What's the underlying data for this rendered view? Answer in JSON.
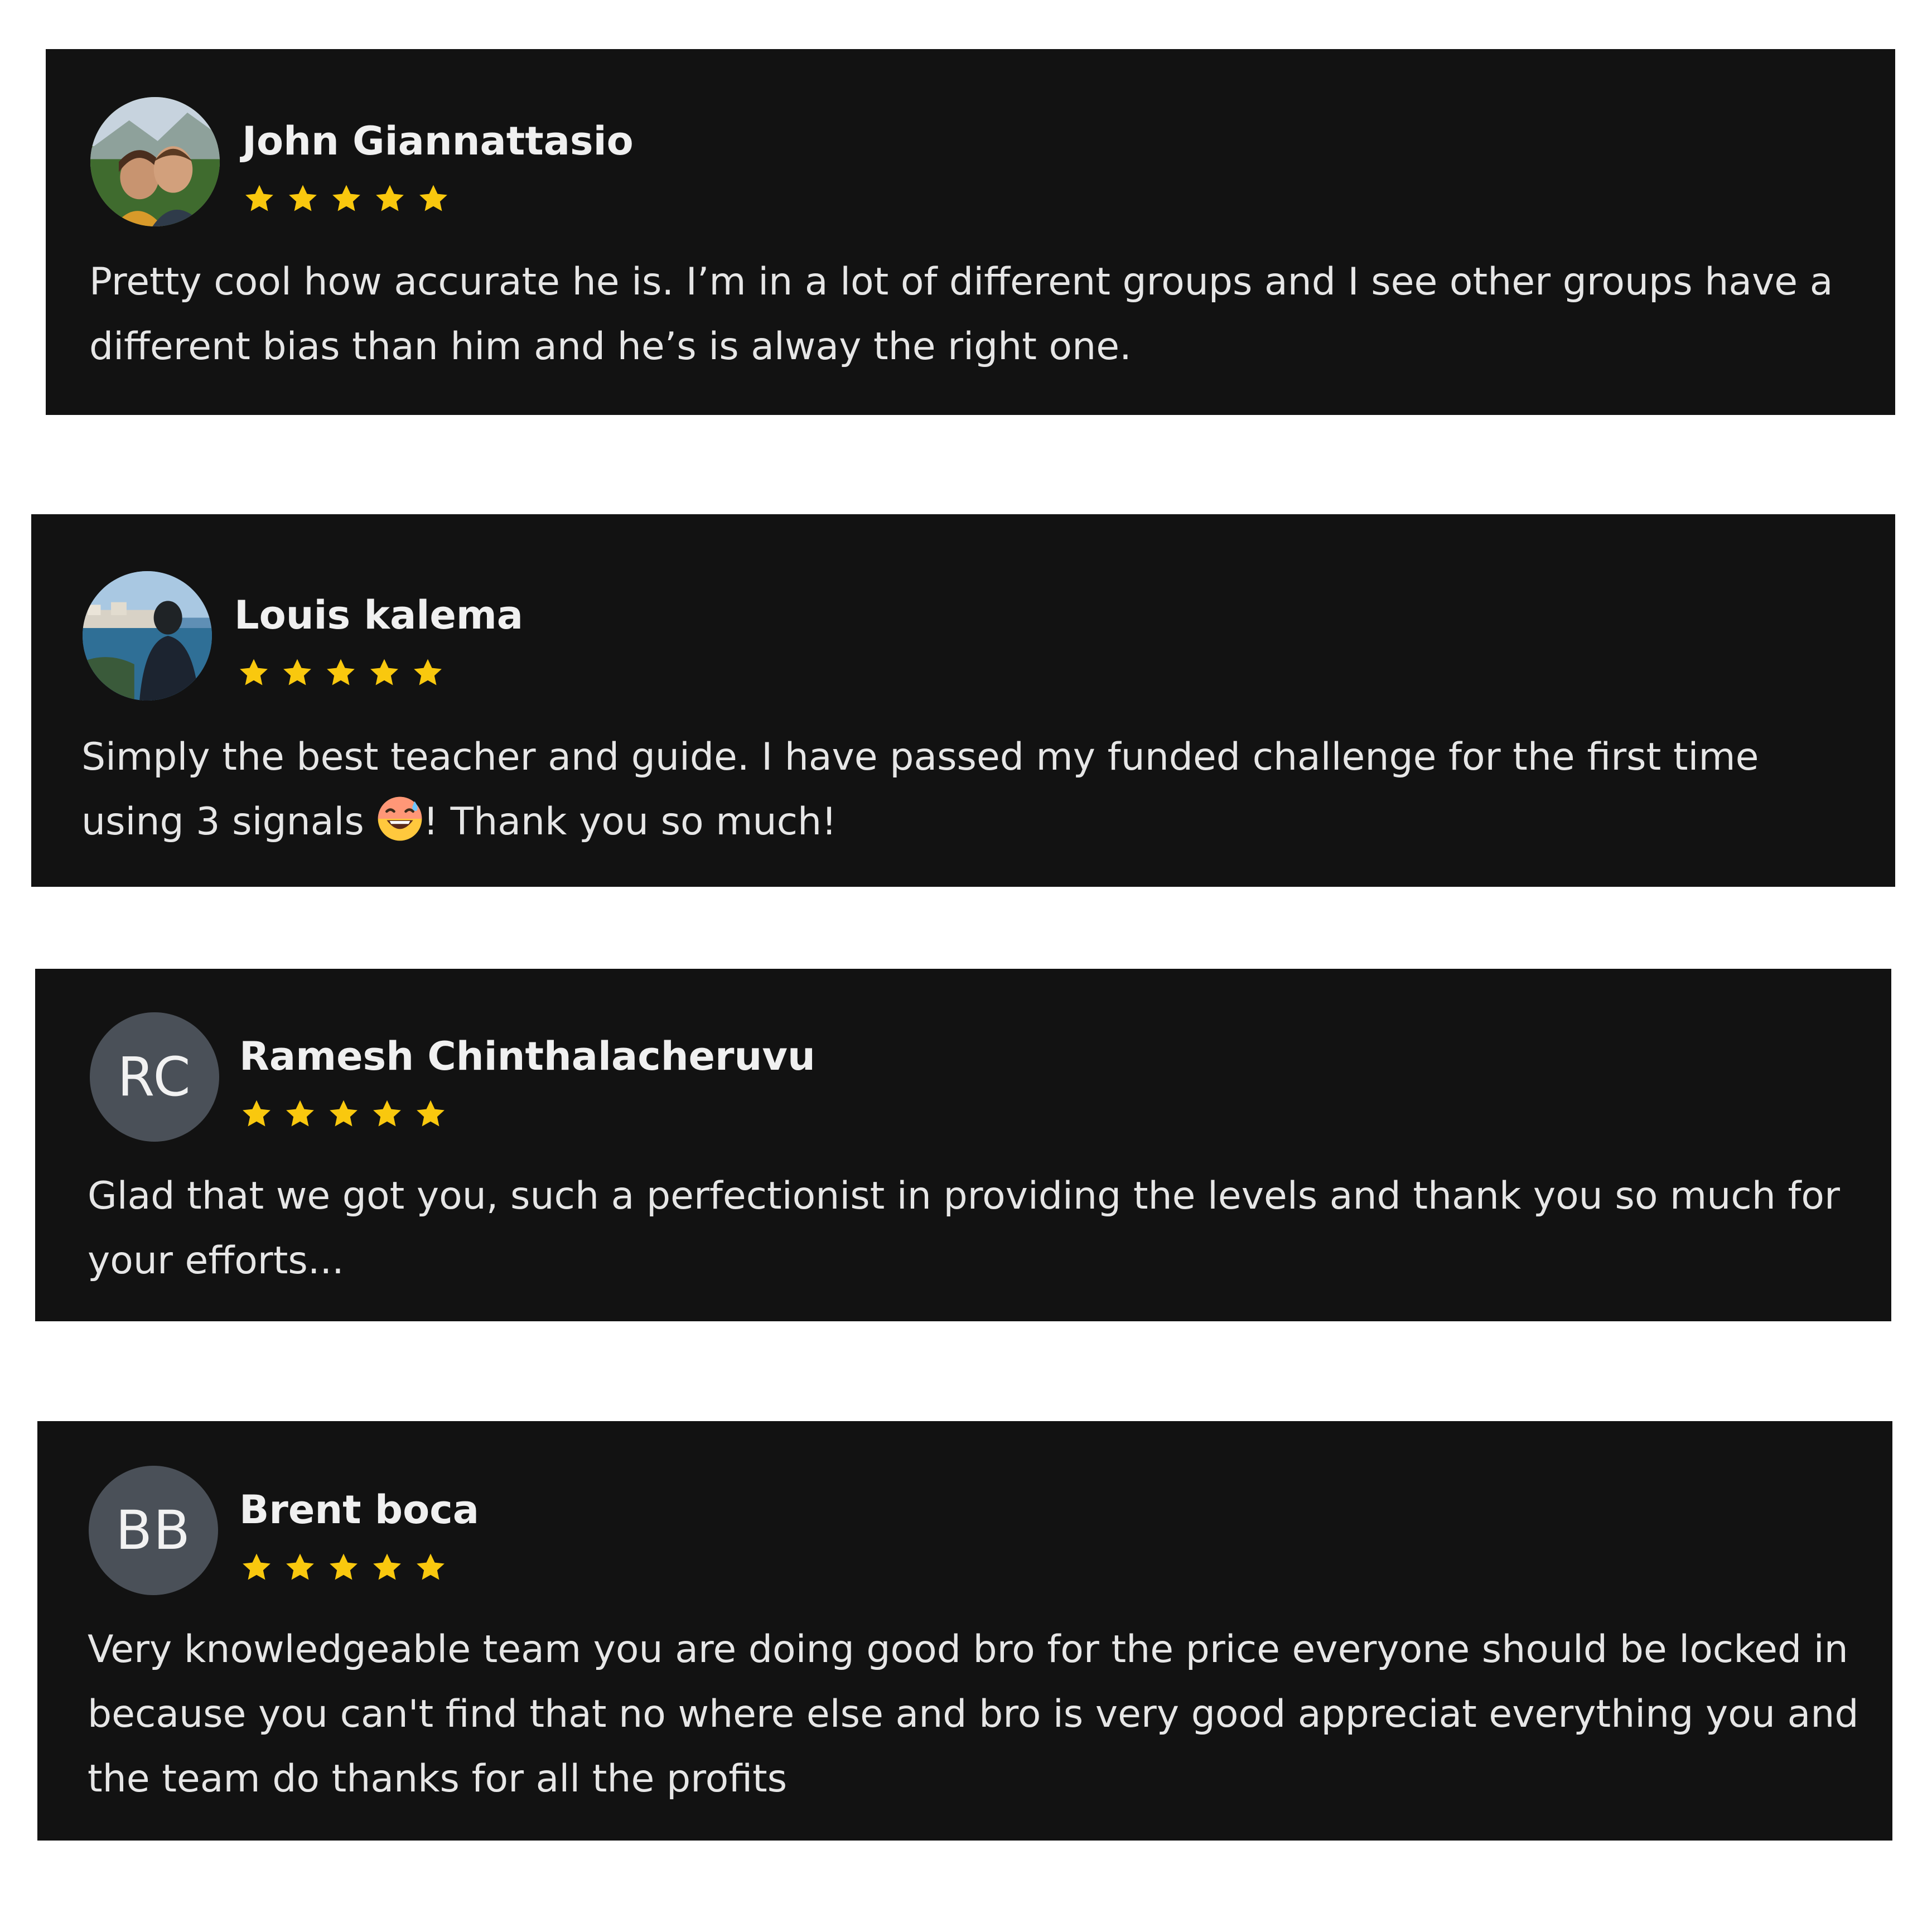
{
  "reviews": [
    {
      "name": "John Giannattasio",
      "rating": 5,
      "avatar": {
        "type": "photo",
        "icon": "couple-photo-avatar"
      },
      "text": "Pretty cool how accurate he is. I’m in a lot of different groups and I see other groups have a different bias than him and he’s is alway the right one."
    },
    {
      "name": "Louis kalema",
      "rating": 5,
      "avatar": {
        "type": "photo",
        "icon": "harbor-photo-avatar"
      },
      "text_before_emoji": "Simply the best teacher and guide. I have passed my funded challenge for the first time using 3 signals",
      "emoji": "smiling-face-with-sweat-icon",
      "text_after_emoji": "! Thank you so much!"
    },
    {
      "name": "Ramesh Chinthalacheruvu",
      "rating": 5,
      "avatar": {
        "type": "initials",
        "initials": "RC"
      },
      "text": "Glad that we got you, such a perfectionist in providing the levels and thank you so much for your efforts..."
    },
    {
      "name": "Brent boca",
      "rating": 5,
      "avatar": {
        "type": "initials",
        "initials": "BB"
      },
      "text": "Very knowledgeable team you are doing good bro for the price everyone should be locked in because you can't find that no where else and bro is very good appreciat everything you and the team do thanks for all the profits"
    }
  ],
  "colors": {
    "card_background": "#121212",
    "star": "#f9c80e",
    "name_text": "#f0f0f0",
    "body_text": "#e6e6e6",
    "initials_avatar_bg": "#4a5058"
  }
}
